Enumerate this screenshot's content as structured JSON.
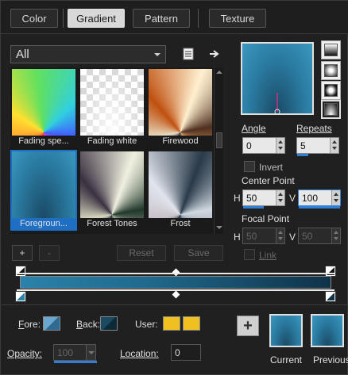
{
  "tabs": [
    {
      "label": "Color"
    },
    {
      "label": "Gradient"
    },
    {
      "label": "Pattern"
    },
    {
      "label": "Texture"
    }
  ],
  "library": {
    "filter_value": "All",
    "items": [
      {
        "label": "Fading spe..."
      },
      {
        "label": "Fading white"
      },
      {
        "label": "Firewood"
      },
      {
        "label": "Foregroun..."
      },
      {
        "label": "Forest Tones"
      },
      {
        "label": "Frost"
      }
    ],
    "selected": "Foregroun...",
    "add_label": "+",
    "remove_label": "-",
    "reset_label": "Reset",
    "save_label": "Save"
  },
  "settings": {
    "angle_label": "Angle",
    "angle_value": "0",
    "repeats_label": "Repeats",
    "repeats_value": "5",
    "invert_label": "Invert",
    "center_point_label": "Center Point",
    "center_h_label": "H",
    "center_h_value": "50",
    "center_v_label": "V",
    "center_v_value": "100",
    "focal_point_label": "Focal Point",
    "focal_h_label": "H",
    "focal_h_value": "50",
    "focal_v_label": "V",
    "focal_v_value": "50",
    "link_label": "Link"
  },
  "editor": {
    "fore_label": "Fore:",
    "back_label": "Back:",
    "user_label": "User:",
    "opacity_label": "Opacity:",
    "opacity_value": "100",
    "location_label": "Location:",
    "location_value": "0",
    "fore_color": "#4a8ab8",
    "back_color": "#1c4a60",
    "user_color": "#f0c020"
  },
  "preview": {
    "current_label": "Current",
    "previous_label": "Previous"
  },
  "colors": {
    "accent": "#2f7ed8",
    "gradient_start": "#2a82aa",
    "gradient_end": "#0f3248"
  }
}
